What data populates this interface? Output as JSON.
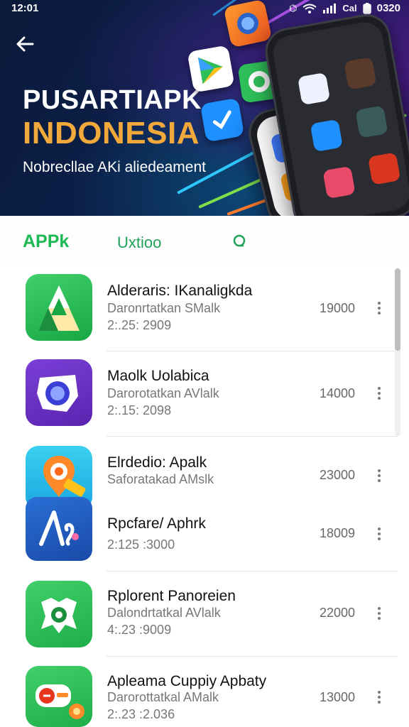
{
  "status_bar": {
    "time": "12:01",
    "right_text": "0320",
    "icons": [
      "nfc-icon",
      "wifi-icon",
      "signal-icon",
      "carrier-label",
      "battery-icon"
    ],
    "carrier": "Cal"
  },
  "hero": {
    "title": "PUSARTIAPK",
    "subtitle": "INDONESIA",
    "tagline": "Nobrecllae AKi aliedeament"
  },
  "tabs": [
    {
      "label": "APPk",
      "active": true
    },
    {
      "label": "Uxtioo",
      "active": false
    },
    {
      "icon": "search-icon"
    }
  ],
  "apps": [
    {
      "name": "Alderaris: IKanaligkda",
      "developer": "Daronrtatkan SMalk",
      "date": "2:.25: 2909",
      "size": "19000",
      "icon": "letter-a-icon"
    },
    {
      "name": "Maolk Uolabica",
      "developer": "Darorotatkan AVlalk",
      "date": "2:.15: 2098",
      "size": "14000",
      "icon": "camera-lens-icon"
    },
    {
      "name": "Elrdedio: Apalk",
      "developer": "Saforatakad AMslk",
      "date": "",
      "size": "23000",
      "icon": "location-pin-icon"
    },
    {
      "name": "Rpcfare/ Aphrk",
      "developer": "",
      "date": "2:125 :3000",
      "size": "18009",
      "icon": "script-a-icon"
    },
    {
      "name": "Rplorent Panoreien",
      "developer": "Dalondrtatkal AVlalk",
      "date": "4:.23 :9009",
      "size": "22000",
      "icon": "shield-badge-icon"
    },
    {
      "name": "Apleama Cuppiy Apbaty",
      "developer": "Darorottatkal AMalk",
      "date": "2:.23 :2.036",
      "size": "13000",
      "icon": "ticket-badge-icon"
    }
  ],
  "colors": {
    "accent_green": "#1db954",
    "hero_orange": "#f2a93b",
    "hero_bg": "#0c1f48"
  }
}
